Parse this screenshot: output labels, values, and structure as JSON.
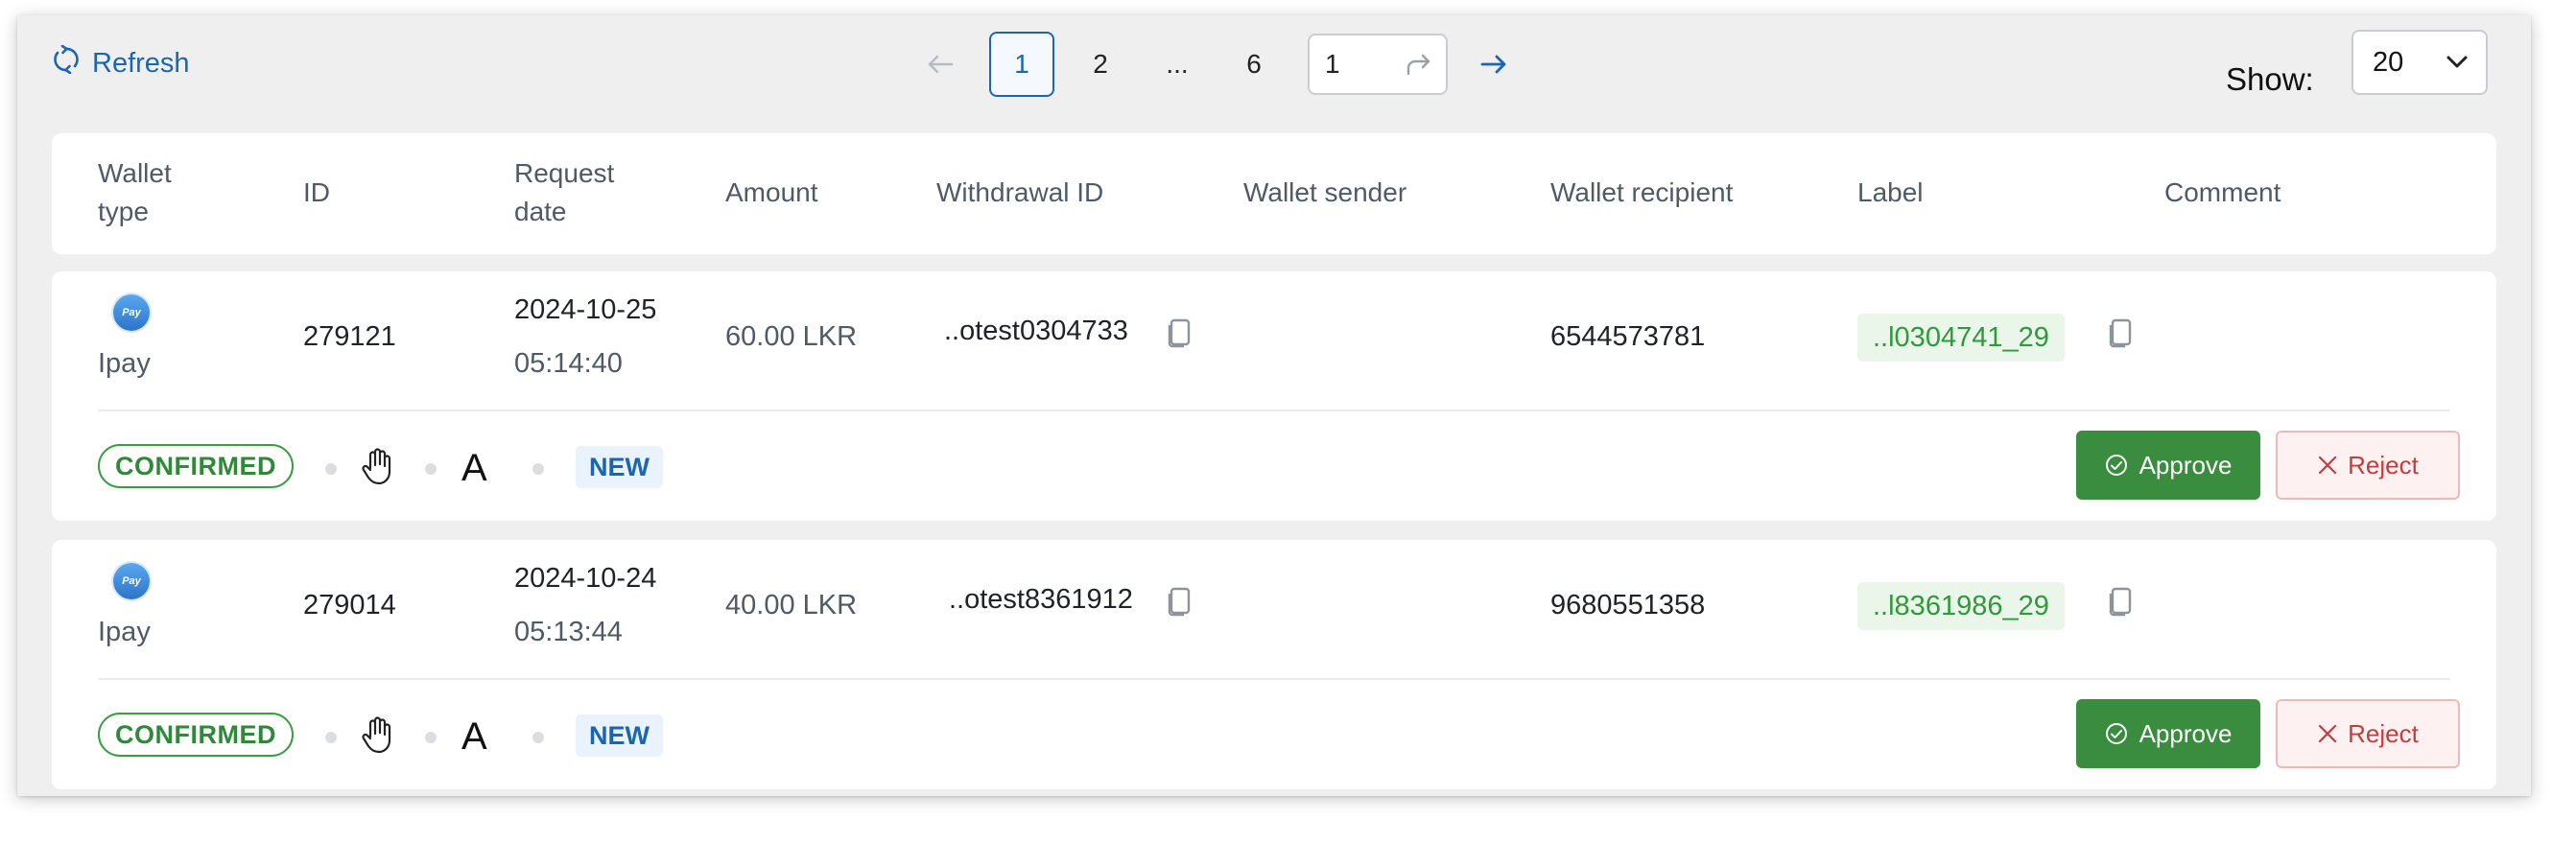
{
  "toolbar": {
    "refresh_label": "Refresh",
    "pagination": {
      "pages": [
        "1",
        "2",
        "...",
        "6"
      ],
      "current_page": "1",
      "goto_value": "1"
    },
    "show_label": "Show:",
    "page_size": "20"
  },
  "table": {
    "columns": {
      "wallet_type": "Wallet type",
      "id": "ID",
      "request_date": "Request date",
      "amount": "Amount",
      "withdrawal_id": "Withdrawal ID",
      "wallet_sender": "Wallet sender",
      "wallet_recipient": "Wallet recipient",
      "label": "Label",
      "comment": "Comment"
    },
    "rows": [
      {
        "wallet_type": "Ipay",
        "wallet_icon_text": "Pay",
        "id": "279121",
        "date": "2024-10-25",
        "time": "05:14:40",
        "amount": "60.00 LKR",
        "withdrawal_id": "..otest0304733",
        "wallet_sender": "",
        "wallet_recipient": "6544573781",
        "label": "..l0304741_29",
        "comment": "",
        "status": "CONFIRMED",
        "type_letter": "A",
        "state": "NEW",
        "approve_label": "Approve",
        "reject_label": "Reject"
      },
      {
        "wallet_type": "Ipay",
        "wallet_icon_text": "Pay",
        "id": "279014",
        "date": "2024-10-24",
        "time": "05:13:44",
        "amount": "40.00 LKR",
        "withdrawal_id": "..otest8361912",
        "wallet_sender": "",
        "wallet_recipient": "9680551358",
        "label": "..l8361986_29",
        "comment": "",
        "status": "CONFIRMED",
        "type_letter": "A",
        "state": "NEW",
        "approve_label": "Approve",
        "reject_label": "Reject"
      }
    ]
  },
  "colors": {
    "link_blue": "#1b66b3",
    "success_green": "#3a8c3f",
    "label_green": "#2f9a39",
    "reject_red": "#c53c3c"
  },
  "icons": [
    "refresh-icon",
    "arrow-left-icon",
    "arrow-right-icon",
    "redo-icon",
    "chevron-down-icon",
    "copy-icon",
    "hand-icon",
    "check-circle-icon",
    "close-icon",
    "ipay-logo-icon"
  ]
}
